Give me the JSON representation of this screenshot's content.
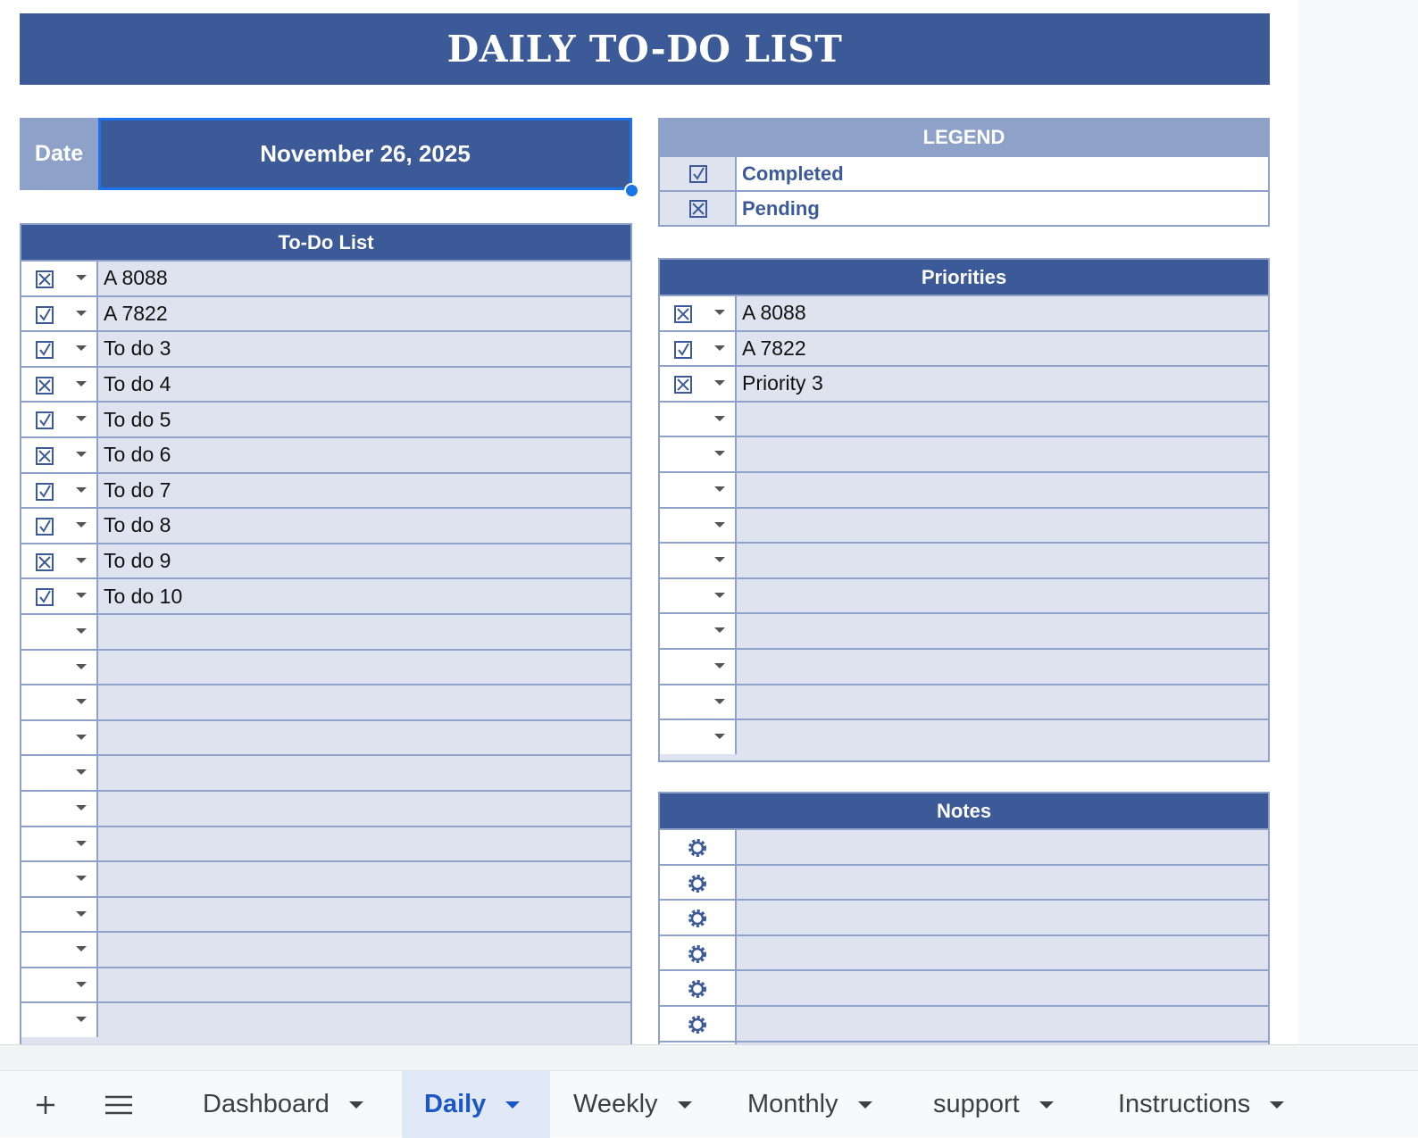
{
  "title": "DAILY TO-DO LIST",
  "date": {
    "label": "Date",
    "value": "November 26, 2025"
  },
  "legend": {
    "title": "LEGEND",
    "items": [
      {
        "icon": "checked-box-icon",
        "label": "Completed"
      },
      {
        "icon": "x-box-icon",
        "label": "Pending"
      }
    ]
  },
  "todo": {
    "title": "To-Do List",
    "rows": [
      {
        "status": "pending",
        "text": "A 8088"
      },
      {
        "status": "completed",
        "text": "A 7822"
      },
      {
        "status": "completed",
        "text": "To do 3"
      },
      {
        "status": "pending",
        "text": "To do 4"
      },
      {
        "status": "completed",
        "text": "To do 5"
      },
      {
        "status": "pending",
        "text": "To do 6"
      },
      {
        "status": "completed",
        "text": "To do 7"
      },
      {
        "status": "completed",
        "text": "To do 8"
      },
      {
        "status": "pending",
        "text": "To do 9"
      },
      {
        "status": "completed",
        "text": "To do 10"
      },
      {
        "status": "",
        "text": ""
      },
      {
        "status": "",
        "text": ""
      },
      {
        "status": "",
        "text": ""
      },
      {
        "status": "",
        "text": ""
      },
      {
        "status": "",
        "text": ""
      },
      {
        "status": "",
        "text": ""
      },
      {
        "status": "",
        "text": ""
      },
      {
        "status": "",
        "text": ""
      },
      {
        "status": "",
        "text": ""
      },
      {
        "status": "",
        "text": ""
      },
      {
        "status": "",
        "text": ""
      },
      {
        "status": "",
        "text": ""
      }
    ]
  },
  "priorities": {
    "title": "Priorities",
    "rows": [
      {
        "status": "pending",
        "text": "A 8088"
      },
      {
        "status": "completed",
        "text": "A 7822"
      },
      {
        "status": "pending",
        "text": "Priority 3"
      },
      {
        "status": "",
        "text": ""
      },
      {
        "status": "",
        "text": ""
      },
      {
        "status": "",
        "text": ""
      },
      {
        "status": "",
        "text": ""
      },
      {
        "status": "",
        "text": ""
      },
      {
        "status": "",
        "text": ""
      },
      {
        "status": "",
        "text": ""
      },
      {
        "status": "",
        "text": ""
      },
      {
        "status": "",
        "text": ""
      },
      {
        "status": "",
        "text": ""
      }
    ]
  },
  "notes": {
    "title": "Notes",
    "rows": [
      {
        "text": ""
      },
      {
        "text": ""
      },
      {
        "text": ""
      },
      {
        "text": ""
      },
      {
        "text": ""
      },
      {
        "text": ""
      },
      {
        "text": ""
      }
    ]
  },
  "colors": {
    "header": "#3c5a97",
    "accent": "#8ea1c8",
    "cell": "#dfe3ef",
    "selection": "#1a73e8"
  },
  "sheet_tabs": {
    "add_icon": "plus-icon",
    "menu_icon": "hamburger-menu-icon",
    "tabs": [
      {
        "label": "Dashboard",
        "active": false
      },
      {
        "label": "Daily",
        "active": true
      },
      {
        "label": "Weekly",
        "active": false
      },
      {
        "label": "Monthly",
        "active": false
      },
      {
        "label": "support",
        "active": false
      },
      {
        "label": "Instructions",
        "active": false
      }
    ]
  }
}
